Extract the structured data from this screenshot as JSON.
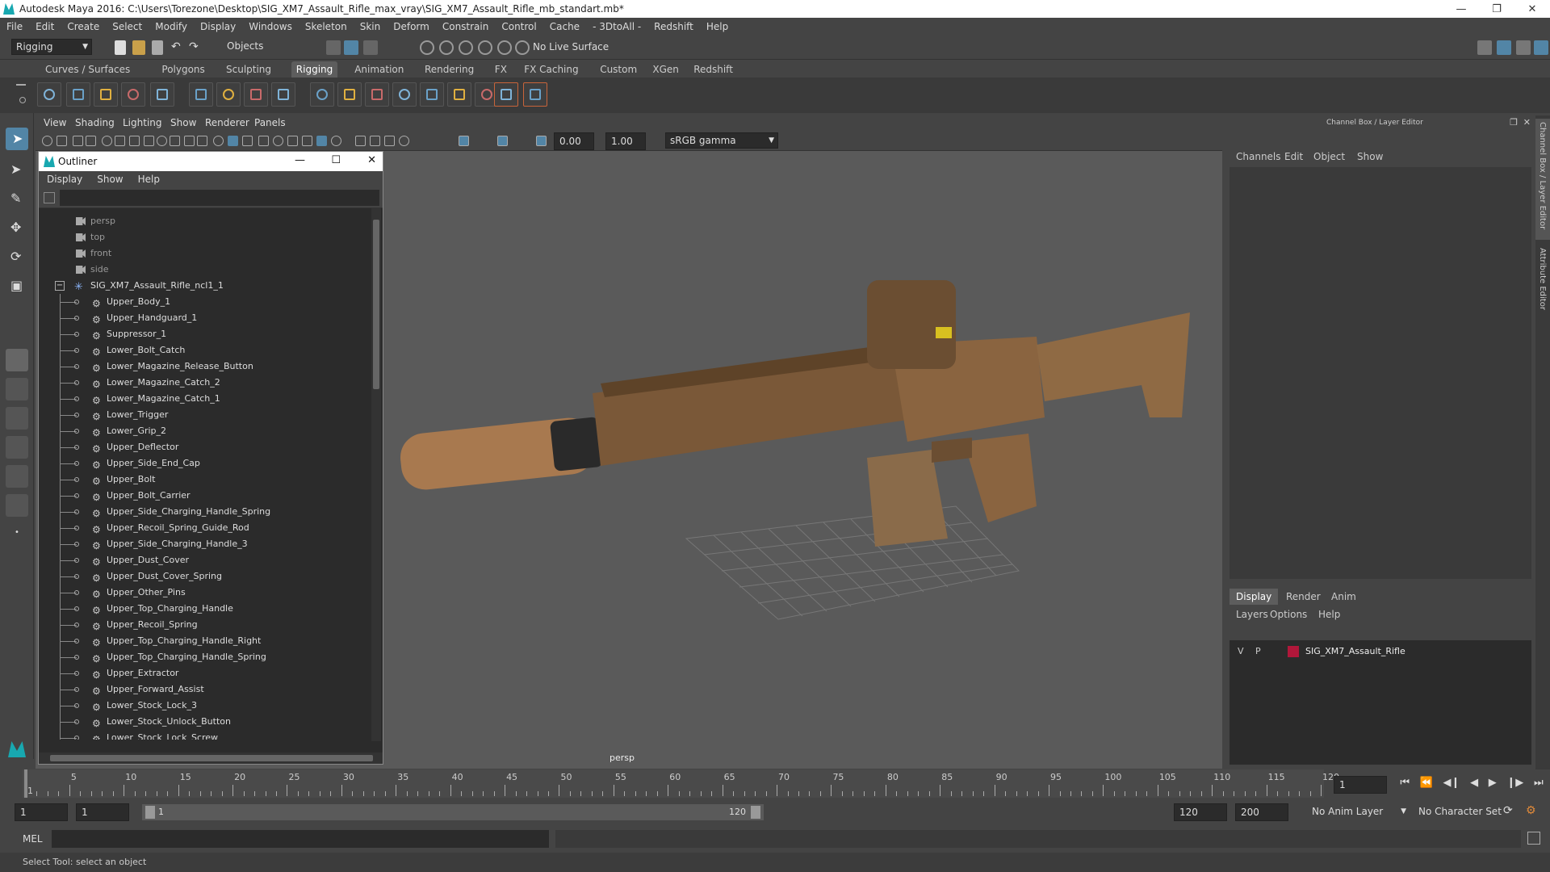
{
  "window": {
    "title": "Autodesk Maya 2016: C:\\Users\\Torezone\\Desktop\\SIG_XM7_Assault_Rifle_max_vray\\SIG_XM7_Assault_Rifle_mb_standart.mb*"
  },
  "menubar": [
    "File",
    "Edit",
    "Create",
    "Select",
    "Modify",
    "Display",
    "Windows",
    "Skeleton",
    "Skin",
    "Deform",
    "Constrain",
    "Control",
    "Cache",
    "- 3DtoAll -",
    "Redshift",
    "Help"
  ],
  "statusline": {
    "mode": "Rigging",
    "selection_mode": "Objects",
    "live_surface": "No Live Surface"
  },
  "shelf_tabs": [
    "Curves / Surfaces",
    "Polygons",
    "Sculpting",
    "Rigging",
    "Animation",
    "Rendering",
    "FX",
    "FX Caching",
    "Custom",
    "XGen",
    "Redshift"
  ],
  "shelf_active": "Rigging",
  "viewport": {
    "menu": [
      "View",
      "Shading",
      "Lighting",
      "Show",
      "Renderer",
      "Panels"
    ],
    "exposure": "0.00",
    "gamma": "1.00",
    "color_space": "sRGB gamma",
    "camera_label": "persp"
  },
  "outliner": {
    "title": "Outliner",
    "menu": [
      "Display",
      "Show",
      "Help"
    ],
    "cameras": [
      "persp",
      "top",
      "front",
      "side"
    ],
    "root": "SIG_XM7_Assault_Rifle_ncl1_1",
    "children": [
      "Upper_Body_1",
      "Upper_Handguard_1",
      "Suppressor_1",
      "Lower_Bolt_Catch",
      "Lower_Magazine_Release_Button",
      "Lower_Magazine_Catch_2",
      "Lower_Magazine_Catch_1",
      "Lower_Trigger",
      "Lower_Grip_2",
      "Upper_Deflector",
      "Upper_Side_End_Cap",
      "Upper_Bolt",
      "Upper_Bolt_Carrier",
      "Upper_Side_Charging_Handle_Spring",
      "Upper_Recoil_Spring_Guide_Rod",
      "Upper_Side_Charging_Handle_3",
      "Upper_Dust_Cover",
      "Upper_Dust_Cover_Spring",
      "Upper_Other_Pins",
      "Upper_Top_Charging_Handle",
      "Upper_Recoil_Spring",
      "Upper_Top_Charging_Handle_Right",
      "Upper_Top_Charging_Handle_Spring",
      "Upper_Extractor",
      "Upper_Forward_Assist",
      "Lower_Stock_Lock_3",
      "Lower_Stock_Unlock_Button",
      "Lower_Stock_Lock_Screw"
    ]
  },
  "channelbox": {
    "title": "Channel Box / Layer Editor",
    "menu": [
      "Channels",
      "Edit",
      "Object",
      "Show"
    ],
    "layer_tabs": [
      "Display",
      "Render",
      "Anim"
    ],
    "layer_menu": [
      "Layers",
      "Options",
      "Help"
    ],
    "layer": {
      "v": "V",
      "p": "P",
      "name": "SIG_XM7_Assault_Rifle",
      "color": "#b0173a"
    },
    "side_tabs": [
      "Channel Box / Layer Editor",
      "Attribute Editor"
    ]
  },
  "timeline": {
    "ticks": [
      "1",
      "5",
      "10",
      "15",
      "20",
      "25",
      "30",
      "35",
      "40",
      "45",
      "50",
      "55",
      "60",
      "65",
      "70",
      "75",
      "80",
      "85",
      "90",
      "95",
      "100",
      "105",
      "110",
      "115",
      "120"
    ],
    "current_frame": "1"
  },
  "range": {
    "start": "1",
    "playback_start": "1",
    "range_start_label": "1",
    "range_end_label": "120",
    "playback_end": "120",
    "end": "200",
    "anim_layer": "No Anim Layer",
    "char_set": "No Character Set"
  },
  "cmdline": {
    "label": "MEL"
  },
  "helpline": {
    "text": "Select Tool: select an object"
  },
  "colors": {
    "accent": "#5285a6",
    "maya_teal": "#18a8b0"
  }
}
